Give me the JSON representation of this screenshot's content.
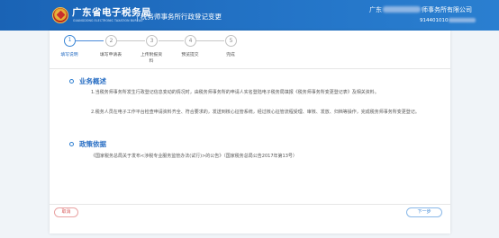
{
  "header": {
    "bureau_name": "广东省电子税务局",
    "bureau_en": "GUANGDONG ELECTRONIC TAXATION BUREAU",
    "page_heading": "税务师事务所行政登记变更",
    "company_prefix": "广东",
    "company_suffix": "师事务所有限公司",
    "taxid_prefix": "914401010"
  },
  "steps": [
    {
      "number": "1",
      "label": "填写说明",
      "active": true
    },
    {
      "number": "2",
      "label": "填写申请表",
      "active": false
    },
    {
      "number": "3",
      "label": "上传附报资料",
      "active": false
    },
    {
      "number": "4",
      "label": "预览提交",
      "active": false
    },
    {
      "number": "5",
      "label": "完成",
      "active": false
    }
  ],
  "sections": {
    "overview_title": "业务概述",
    "overview_p1": "1.当税务师事务所发生行政登记信息变动的情况时，由税务师事务所的申请人实名登陆电子税务局填报《税务师事务所变更登记表》及相关资料。",
    "overview_p2": "2.税务人员在电子工作平台检查申请资料齐全、符合要求的，发送到核心征管系统，经过核心征管流程受理、审核、发放、归档等操作，完成税务师事务所变更登记。",
    "basis_title": "政策依据",
    "basis_p1": "《国家税务总局关于发布<涉税专业服务监管办法(试行)>的公告》（国家税务总局公告2017年第13号）"
  },
  "buttons": {
    "back": "取消",
    "next": "下一步"
  },
  "colors": {
    "header_blue": "#1a63b5",
    "accent_blue": "#2a6fc4",
    "cancel_red": "#d85a5a"
  }
}
